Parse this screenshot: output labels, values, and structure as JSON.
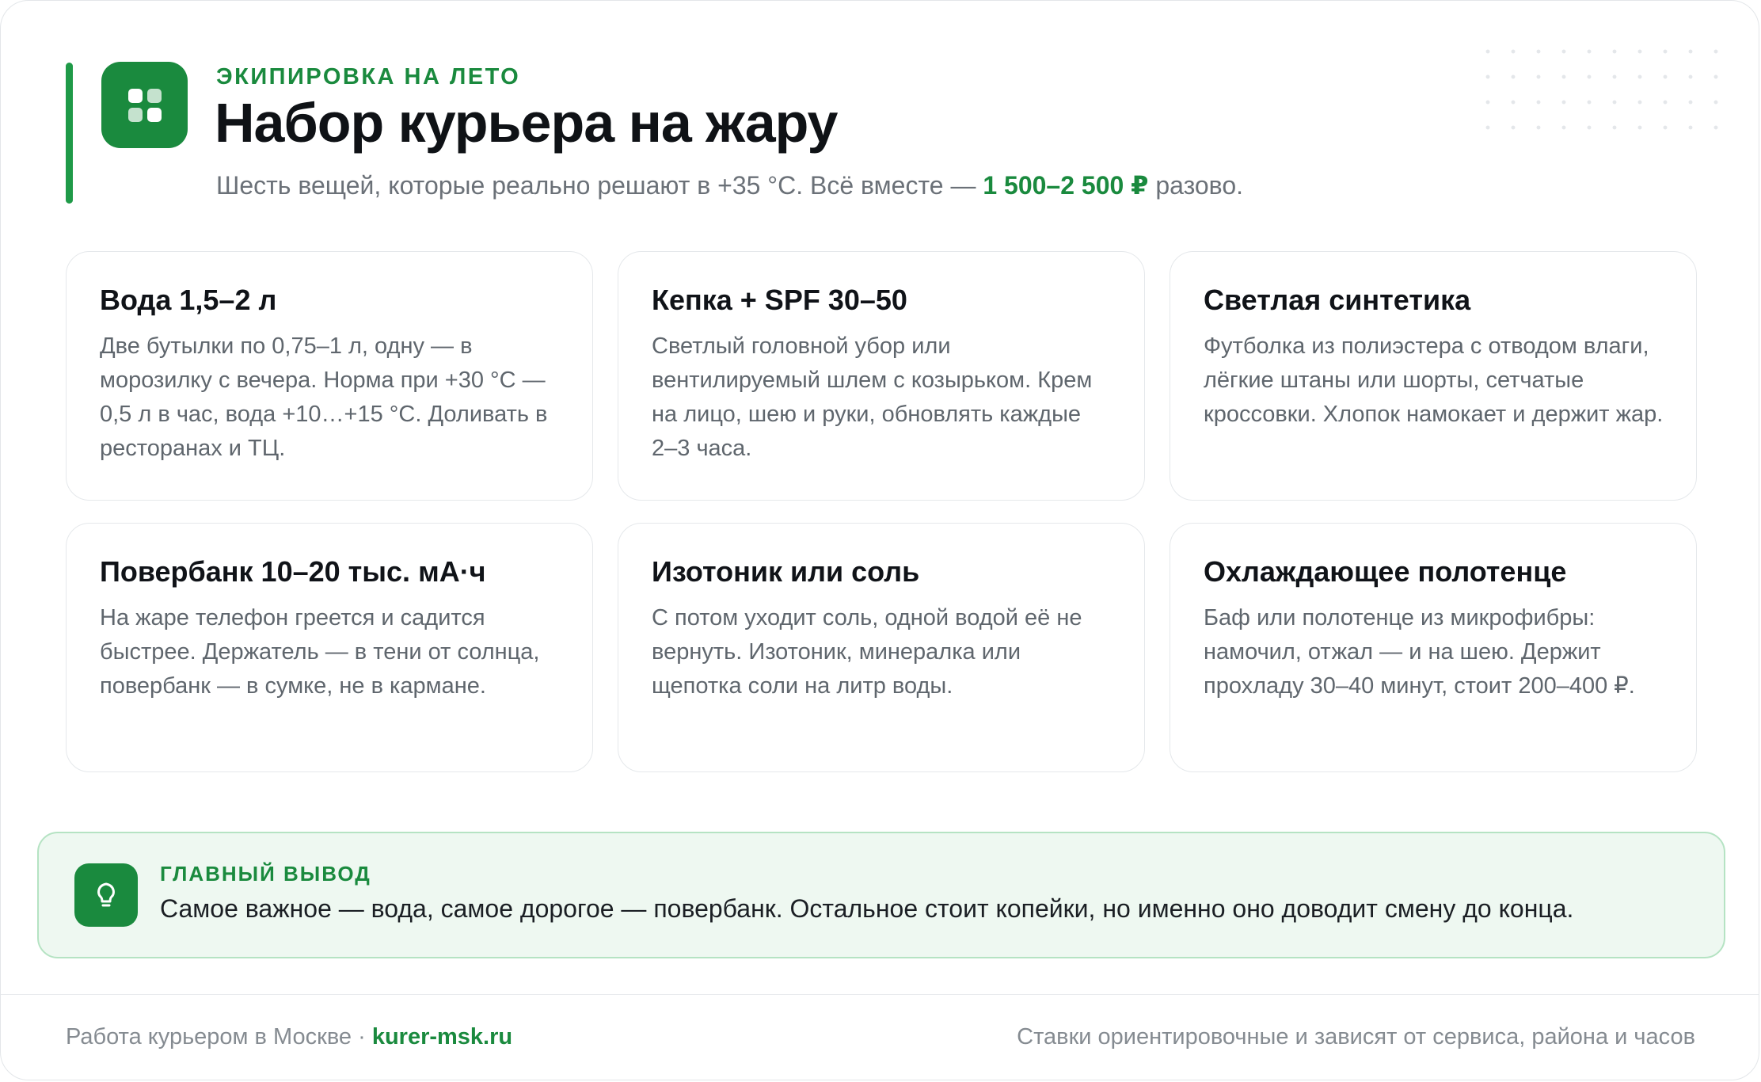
{
  "header": {
    "eyebrow": "ЭКИПИРОВКА НА ЛЕТО",
    "title": "Набор курьера на жару",
    "subtitle_before": "Шесть вещей, которые реально решают в +35 °C. Всё вместе — ",
    "subtitle_highlight": "1 500–2 500 ₽",
    "subtitle_after": " разово.",
    "icon": "grid-icon",
    "accent_color": "#1a8a3e"
  },
  "cards": [
    {
      "title": "Вода 1,5–2 л",
      "text": "Две бутылки по 0,75–1 л, одну — в морозилку с вечера. Норма при +30 °C — 0,5 л в час, вода +10…+15 °C. Доливать в ресторанах и ТЦ."
    },
    {
      "title": "Кепка + SPF 30–50",
      "text": "Светлый головной убор или вентилируемый шлем с козырьком. Крем на лицо, шею и руки, обновлять каждые 2–3 часа."
    },
    {
      "title": "Светлая синтетика",
      "text": "Футболка из полиэстера с отводом влаги, лёгкие штаны или шорты, сетчатые кроссовки. Хлопок намокает и держит жар."
    },
    {
      "title": "Повербанк 10–20 тыс. мА·ч",
      "text": "На жаре телефон греется и садится быстрее. Держатель — в тени от солнца, повербанк — в сумке, не в кармане."
    },
    {
      "title": "Изотоник или соль",
      "text": "С потом уходит соль, одной водой её не вернуть. Изотоник, минералка или щепотка соли на литр воды."
    },
    {
      "title": "Охлаждающее полотенце",
      "text": "Баф или полотенце из микрофибры: намочил, отжал — и на шею. Держит прохладу 30–40 минут, стоит 200–400 ₽."
    }
  ],
  "conclusion": {
    "icon": "lightbulb-icon",
    "label": "ГЛАВНЫЙ ВЫВОД",
    "text": "Самое важное — вода, самое дорогое — повербанк. Остальное стоит копейки, но именно оно доводит смену до конца."
  },
  "footer": {
    "left_text": "Работа курьером в Москве · ",
    "site": "kurer-msk.ru",
    "right_text": "Ставки ориентировочные и зависят от сервиса, района и часов"
  }
}
